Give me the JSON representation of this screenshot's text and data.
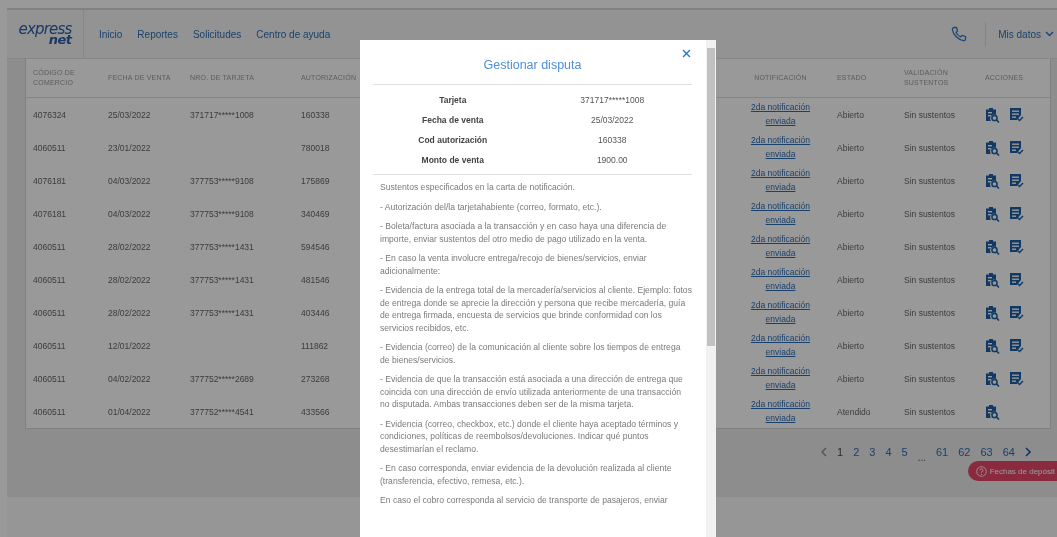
{
  "header": {
    "logo": {
      "top": "express",
      "bottom": "net"
    },
    "nav": [
      "Inicio",
      "Reportes",
      "Solicitudes",
      "Centro de ayuda"
    ],
    "account": "Mis datos"
  },
  "table": {
    "columns": [
      "CÓDIGO DE COMERCIO",
      "FECHA DE VENTA",
      "NRO. DE TARJETA",
      "AUTORIZACIÓN",
      "NOTIFICACIÓN",
      "ESTADO",
      "VALIDACIÓN SUSTENTOS",
      "ACCIONES"
    ],
    "rows": [
      {
        "codigo": "4076324",
        "fecha": "25/03/2022",
        "tarjeta": "371717*****1008",
        "autorizacion": "160338",
        "notificacion": "2da notificación enviada",
        "estado": "Abierto",
        "validacion": "Sin sustentos",
        "actions": [
          {
            "kind": "review"
          },
          {
            "kind": "edit"
          }
        ]
      },
      {
        "codigo": "4060511",
        "fecha": "23/01/2022",
        "autorizacion": "780018",
        "notificacion": "2da notificación enviada",
        "estado": "Abierto",
        "validacion": "Sin sustentos",
        "actions": [
          {
            "kind": "review"
          },
          {
            "kind": "edit"
          }
        ]
      },
      {
        "codigo": "4076181",
        "fecha": "04/03/2022",
        "tarjeta": "377753*****9108",
        "autorizacion": "175869",
        "notificacion": "2da notificación enviada",
        "estado": "Abierto",
        "validacion": "Sin sustentos",
        "actions": [
          {
            "kind": "review"
          },
          {
            "kind": "edit"
          }
        ]
      },
      {
        "codigo": "4076181",
        "fecha": "04/03/2022",
        "tarjeta": "377753*****9108",
        "autorizacion": "340469",
        "notificacion": "2da notificación enviada",
        "estado": "Abierto",
        "validacion": "Sin sustentos",
        "actions": [
          {
            "kind": "review"
          },
          {
            "kind": "edit"
          }
        ]
      },
      {
        "codigo": "4060511",
        "fecha": "28/02/2022",
        "tarjeta": "377753*****1431",
        "autorizacion": "594546",
        "notificacion": "2da notificación enviada",
        "estado": "Abierto",
        "validacion": "Sin sustentos",
        "actions": [
          {
            "kind": "review"
          },
          {
            "kind": "edit"
          }
        ]
      },
      {
        "codigo": "4060511",
        "fecha": "28/02/2022",
        "tarjeta": "377753*****1431",
        "autorizacion": "481546",
        "notificacion": "2da notificación enviada",
        "estado": "Abierto",
        "validacion": "Sin sustentos",
        "actions": [
          {
            "kind": "review"
          },
          {
            "kind": "edit"
          }
        ]
      },
      {
        "codigo": "4060511",
        "fecha": "28/02/2022",
        "tarjeta": "377753*****1431",
        "autorizacion": "403446",
        "notificacion": "2da notificación enviada",
        "estado": "Abierto",
        "validacion": "Sin sustentos",
        "actions": [
          {
            "kind": "review"
          },
          {
            "kind": "edit"
          }
        ]
      },
      {
        "codigo": "4060511",
        "fecha": "12/01/2022",
        "autorizacion": "111862",
        "notificacion": "2da notificación enviada",
        "estado": "Abierto",
        "validacion": "Sin sustentos",
        "actions": [
          {
            "kind": "review"
          },
          {
            "kind": "edit"
          }
        ]
      },
      {
        "codigo": "4060511",
        "fecha": "04/02/2022",
        "tarjeta": "377752*****2689",
        "autorizacion": "273268",
        "notificacion": "2da notificación enviada",
        "estado": "Abierto",
        "validacion": "Sin sustentos",
        "actions": [
          {
            "kind": "review"
          },
          {
            "kind": "edit"
          }
        ]
      },
      {
        "codigo": "4060511",
        "fecha": "01/04/2022",
        "tarjeta": "377752*****4541",
        "autorizacion": "433566",
        "notificacion": "2da notificación enviada",
        "estado": "Atendido",
        "validacion": "Sin sustentos",
        "actions": [
          {
            "kind": "review"
          }
        ]
      }
    ]
  },
  "pagination": [
    {
      "kind": "prev"
    },
    {
      "kind": "page",
      "label": "1",
      "selected": true
    },
    {
      "kind": "page",
      "label": "2",
      "selected": false
    },
    {
      "kind": "page",
      "label": "3",
      "selected": false
    },
    {
      "kind": "page",
      "label": "4",
      "selected": false
    },
    {
      "kind": "page",
      "label": "5",
      "selected": false
    },
    {
      "kind": "ellipsis",
      "label": "..."
    },
    {
      "kind": "page",
      "label": "61",
      "selected": false
    },
    {
      "kind": "page",
      "label": "62",
      "selected": false
    },
    {
      "kind": "page",
      "label": "63",
      "selected": false
    },
    {
      "kind": "page",
      "label": "64",
      "selected": false
    },
    {
      "kind": "next"
    }
  ],
  "floating_button": {
    "label": "Fechas de depósit"
  },
  "modal": {
    "title": "Gestionar disputa",
    "details": [
      {
        "label": "Tarjeta",
        "value": "371717*****1008"
      },
      {
        "label": "Fecha de venta",
        "value": "25/03/2022"
      },
      {
        "label": "Cod autorización",
        "value": "160338"
      },
      {
        "label": "Monto de venta",
        "value": "1900.00"
      }
    ],
    "paragraphs": [
      "Sustentos especificados en la carta de notificación.",
      "- Autorización del/la tarjetahabiente (correo, formato, etc.).",
      "- Boleta/factura asociada a la transacción y en caso haya una diferencia de importe, enviar sustentos del otro medio de pago utilizado en la venta.",
      "- En caso la venta involucre entrega/recojo de bienes/servicios, enviar adicionalmente:",
      "- Evidencia de la entrega total de la mercadería/servicios al cliente. Ejemplo: fotos de entrega donde se aprecie la dirección y persona que recibe mercadería, guía de entrega firmada, encuesta de servicios que brinde conformidad con los servicios recibidos, etc.",
      "- Evidencia (correo) de la comunicación al cliente sobre los tiempos de entrega de bienes/servicios.",
      "- Evidencia de que la transacción está asociada a una dirección de entrega que coincida con una dirección de envío utilizada anteriormente de una transacción no disputada. Ambas transacciones deben ser de la misma tarjeta.",
      "- Evidencia (correo, checkbox, etc.) donde el cliente haya aceptado términos y condiciones, políticas de reembolsos/devoluciones. Indicar qué puntos desestimarían el reclamo.",
      "- En caso corresponda, enviar evidencia de la devolución realizada al cliente (transferencia, efectivo, remesa, etc.).",
      "En caso el cobro corresponda al servicio de transporte de pasajeros, enviar"
    ]
  }
}
